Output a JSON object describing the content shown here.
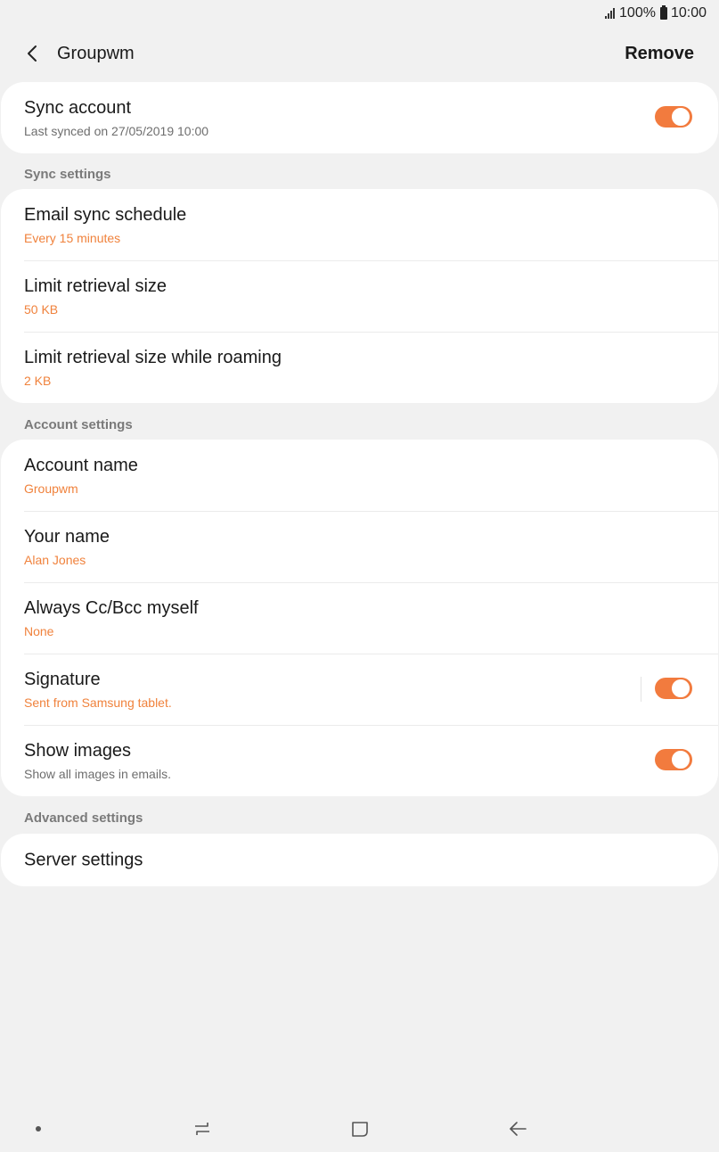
{
  "status_bar": {
    "battery": "100%",
    "time": "10:00"
  },
  "header": {
    "title": "Groupwm",
    "remove_label": "Remove"
  },
  "sync_account": {
    "title": "Sync account",
    "subtitle": "Last synced on 27/05/2019  10:00",
    "enabled": true
  },
  "sync_settings": {
    "label": "Sync settings",
    "items": [
      {
        "title": "Email sync schedule",
        "value": "Every 15 minutes"
      },
      {
        "title": "Limit retrieval size",
        "value": "50 KB"
      },
      {
        "title": "Limit retrieval size while roaming",
        "value": "2 KB"
      }
    ]
  },
  "account_settings": {
    "label": "Account settings",
    "items": [
      {
        "title": "Account name",
        "value": "Groupwm"
      },
      {
        "title": "Your name",
        "value": "Alan Jones"
      },
      {
        "title": "Always Cc/Bcc myself",
        "value": "None"
      },
      {
        "title": "Signature",
        "value": "Sent from Samsung tablet.",
        "enabled": true
      },
      {
        "title": "Show images",
        "value": "Show all images in emails.",
        "enabled": true
      }
    ]
  },
  "advanced_settings": {
    "label": "Advanced settings",
    "items": [
      {
        "title": "Server settings"
      }
    ]
  },
  "colors": {
    "accent": "#f27b3e",
    "background": "#f1f1f1",
    "card": "#ffffff"
  },
  "nav_bar": {
    "icons": [
      "dot-icon",
      "recent-apps-icon",
      "home-icon",
      "back-arrow-icon"
    ]
  }
}
